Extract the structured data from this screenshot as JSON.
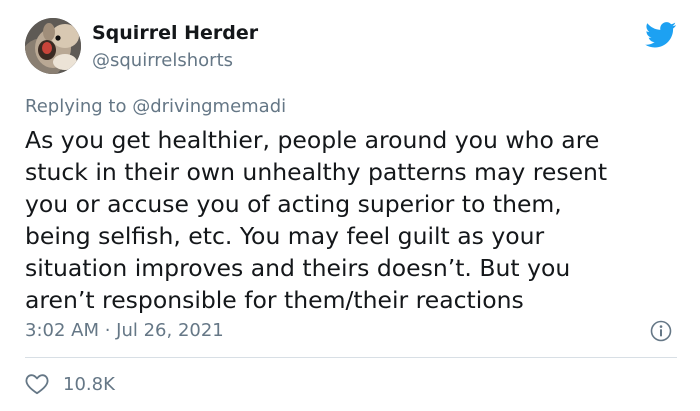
{
  "user": {
    "display_name": "Squirrel Herder",
    "handle": "@squirrelshorts"
  },
  "reply": {
    "prefix": "Replying to",
    "mention": "@drivingmemadi"
  },
  "tweet": {
    "lines": [
      "As you get healthier, people around you who are",
      "stuck in their own unhealthy patterns may resent",
      "you or accuse you of acting superior to them,",
      "being selfish, etc. You may feel guilt as your",
      "situation improves and theirs doesn’t. But you",
      "aren’t responsible for them/their reactions"
    ],
    "timestamp": "3:02 AM · Jul 26, 2021"
  },
  "actions": {
    "like_count": "10.8K"
  },
  "icons": {
    "brand": "twitter-bird-icon",
    "info": "info-icon",
    "like": "heart-icon"
  },
  "colors": {
    "brand_blue": "#1da1f2",
    "secondary_text": "#657786",
    "primary_text": "#14171a",
    "divider": "#d8dfe5"
  }
}
